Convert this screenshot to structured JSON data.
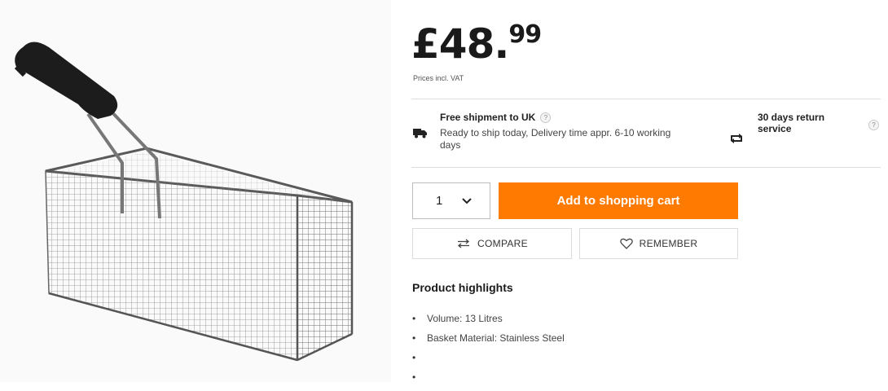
{
  "product": {
    "image_alt": "Fryer basket with black handle",
    "price_main": "£48.",
    "price_cents": "99",
    "vat_note": "Prices incl. VAT"
  },
  "shipping": {
    "title": "Free shipment to UK",
    "help": "?",
    "text": "Ready to ship today, Delivery time appr. 6-10 working days",
    "icon": "truck-icon"
  },
  "returns": {
    "text": "30 days return service",
    "help": "?",
    "icon": "return-arrows-icon"
  },
  "purchase": {
    "quantity": "1",
    "add_to_cart": "Add to shopping cart",
    "compare": "COMPARE",
    "remember": "REMEMBER"
  },
  "highlights": {
    "title": "Product highlights",
    "items": [
      "Volume: 13 Litres",
      "Basket Material: Stainless Steel",
      "",
      ""
    ]
  },
  "colors": {
    "accent": "#ff7a00",
    "divider": "#dcdcdc"
  }
}
